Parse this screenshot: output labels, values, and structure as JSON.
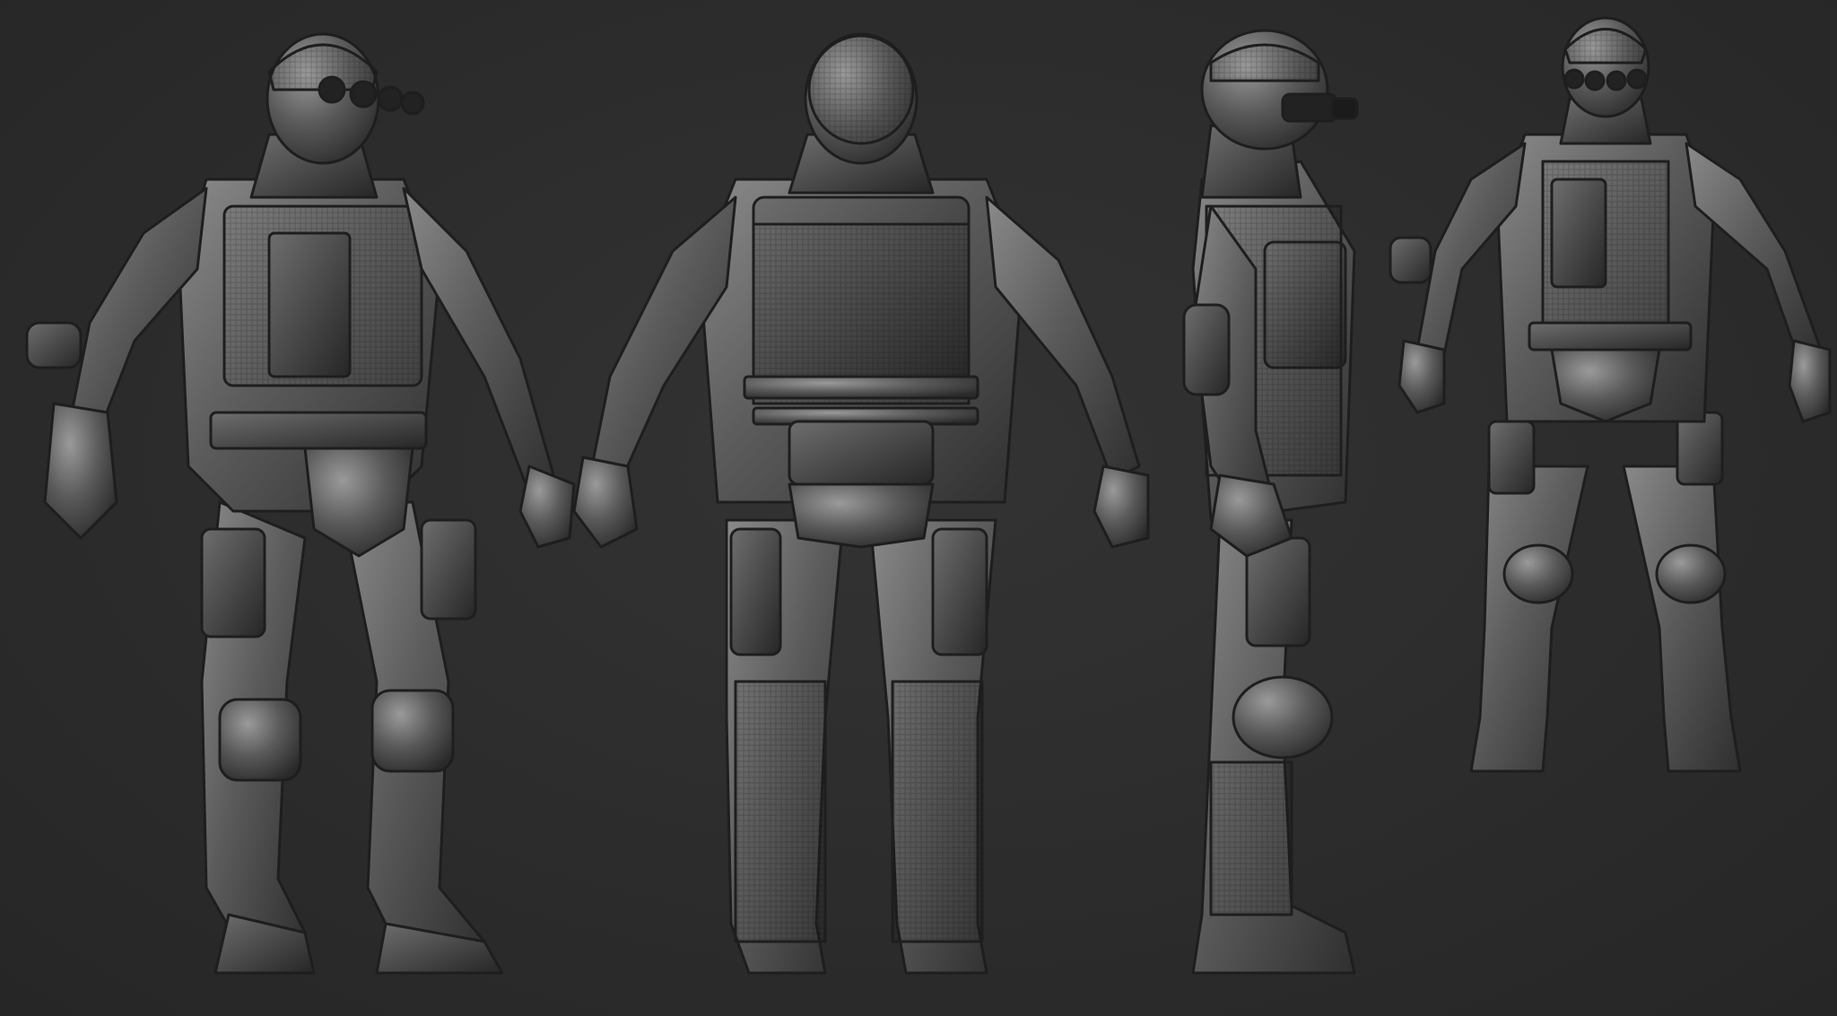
{
  "scene": {
    "background_color": "#2c2c2c",
    "material_color": "#6a6a6a",
    "subject": "tactical-soldier-sculpt",
    "views": [
      {
        "id": "front-three-quarter",
        "facing": "front-left"
      },
      {
        "id": "back",
        "facing": "back"
      },
      {
        "id": "side",
        "facing": "right"
      },
      {
        "id": "front",
        "facing": "front"
      }
    ]
  }
}
